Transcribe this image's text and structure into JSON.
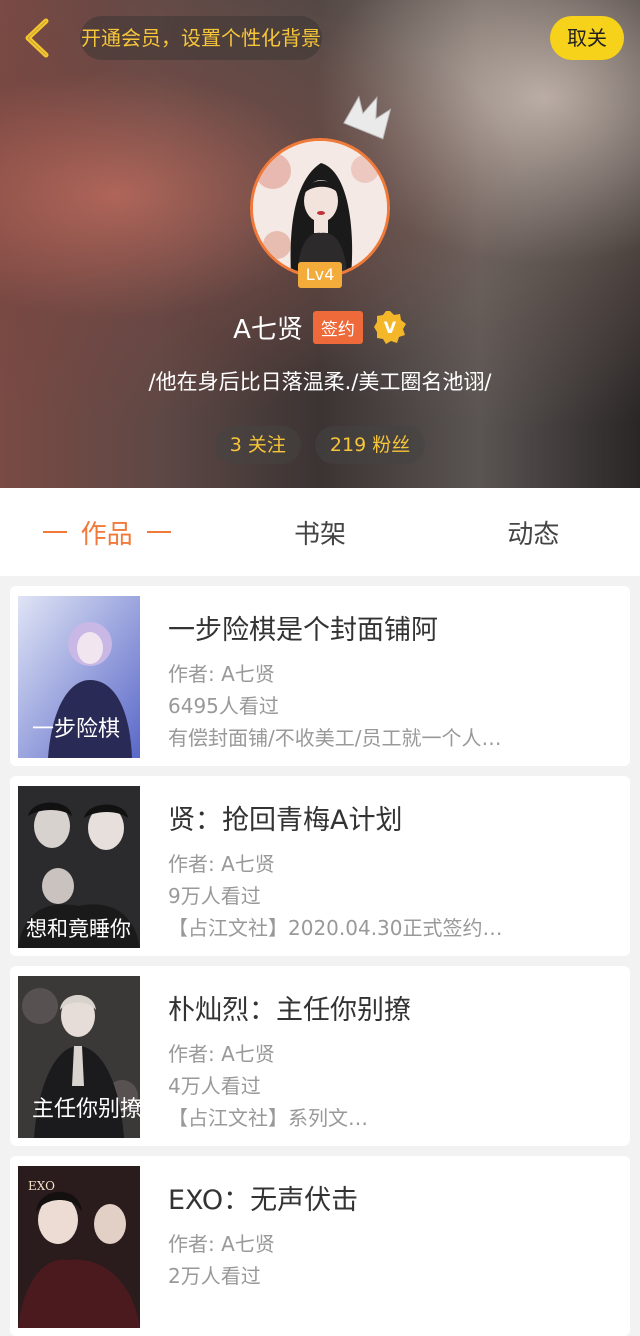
{
  "header": {
    "vip_prompt": "开通会员，设置个性化背景",
    "unfollow_label": "取关",
    "level": "Lv4",
    "username": "A七贤",
    "sign_badge": "签约",
    "verified_badge": "V",
    "bio": "/他在身后比日落温柔./美工圈名池诩/",
    "following": "3 关注",
    "followers": "219 粉丝"
  },
  "tabs": [
    {
      "label": "作品",
      "active": true
    },
    {
      "label": "书架",
      "active": false
    },
    {
      "label": "动态",
      "active": false
    }
  ],
  "books": [
    {
      "title": "一步险棋是个封面铺阿",
      "author": "作者: A七贤",
      "views": "6495人看过",
      "desc": "有偿封面铺/不收美工/员工就一个人…",
      "cover_text": "一步险棋"
    },
    {
      "title": "贤：抢回青梅A计划",
      "author": "作者: A七贤",
      "views": "9万人看过",
      "desc": "【占江文社】2020.04.30正式签约…",
      "cover_text": "想和竟睡你"
    },
    {
      "title": "朴灿烈：主任你别撩",
      "author": "作者: A七贤",
      "views": "4万人看过",
      "desc": "【占江文社】系列文…",
      "cover_text": "主任你别撩"
    },
    {
      "title": "EXO：无声伏击",
      "author": "作者: A七贤",
      "views": "2万人看过",
      "desc": "",
      "cover_text": "EXO"
    }
  ],
  "colors": {
    "accent_orange": "#ef7a3a",
    "vip_yellow": "#f7c53a",
    "button_yellow": "#f6d21a"
  }
}
